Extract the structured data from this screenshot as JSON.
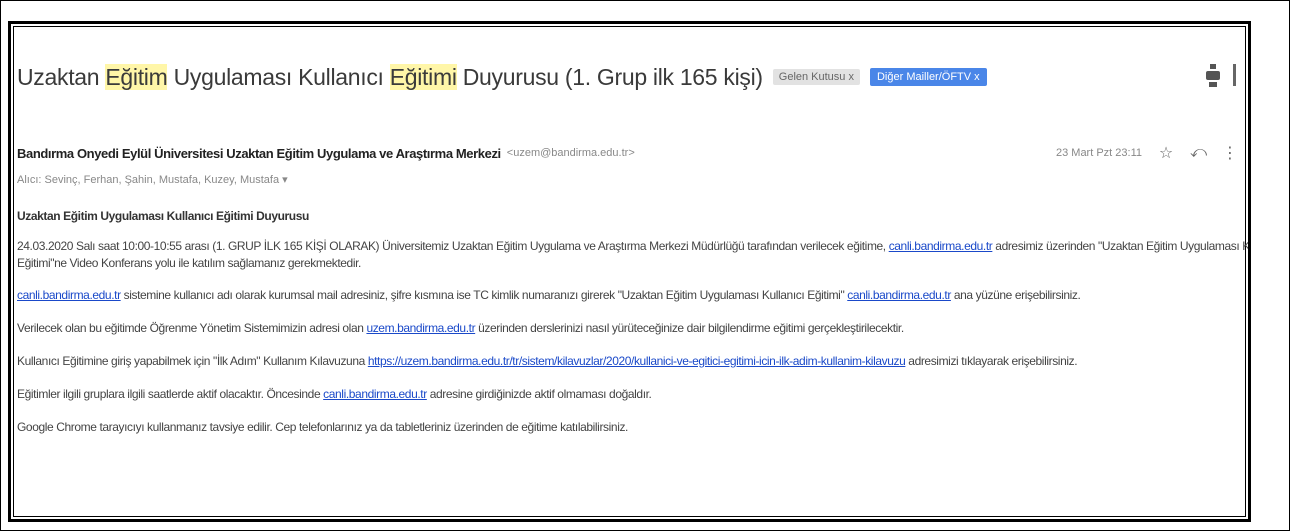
{
  "email": {
    "subject": {
      "p1": "Uzaktan ",
      "h1": "Eğitim",
      "p2": " Uygulaması Kullanıcı ",
      "h2": "Eğitimi",
      "p3": " Duyurusu (1. Grup ilk 165 kişi)"
    },
    "labels": {
      "inbox": "Gelen Kutusu x",
      "other": "Diğer Mailler/ÖFTV x"
    },
    "sender": {
      "name": "Bandırma Onyedi Eylül Üniversitesi Uzaktan Eğitim Uygulama ve Araştırma Merkezi",
      "email": "<uzem@bandirma.edu.tr>"
    },
    "date": "23 Mart Pzt 23:11",
    "recipients": "Alıcı: Sevinç, Ferhan, Şahin, Mustafa, Kuzey, Mustafa ▾",
    "body": {
      "heading": "Uzaktan Eğitim Uygulaması Kullanıcı Eğitimi Duyurusu",
      "p1a": "24.03.2020 Salı saat 10:00-10:55 arası (1. GRUP İLK 165 KİŞİ OLARAK) Üniversitemiz Uzaktan Eğitim Uygulama ve Araştırma Merkezi Müdürlüğü tarafından verilecek eğitime, ",
      "p1link": "canli.bandirma.edu.tr",
      "p1b": " adresimiz üzerinden \"Uzaktan Eğitim Uygulaması Kullanıcı",
      "p1c": "Eğitimi\"ne Video Konferans yolu ile katılım sağlamanız gerekmektedir.",
      "p2link": "canli.bandirma.edu.tr",
      "p2a": " sistemine kullanıcı adı olarak kurumsal mail adresiniz, şifre kısmına ise TC kimlik numaranızı girerek \"Uzaktan Eğitim Uygulaması Kullanıcı Eğitimi\" ",
      "p2link2": "canli.bandirma.edu.tr",
      "p2b": " ana yüzüne erişebilirsiniz.",
      "p3a": "Verilecek olan bu eğitimde Öğrenme Yönetim Sistemimizin adresi olan ",
      "p3link": "uzem.bandirma.edu.tr",
      "p3b": " üzerinden derslerinizi nasıl yürüteceğinize dair bilgilendirme eğitimi gerçekleştirilecektir.",
      "p4a": "Kullanıcı Eğitimine giriş yapabilmek için \"İlk Adım\" Kullanım Kılavuzuna ",
      "p4link": "https://uzem.bandirma.edu.tr/tr/sistem/kilavuzlar/2020/kullanici-ve-egitici-egitimi-icin-ilk-adim-kullanim-kilavuzu",
      "p4b": " adresimizi tıklayarak erişebilirsiniz.",
      "p5a": "Eğitimler ilgili gruplara ilgili saatlerde aktif olacaktır. Öncesinde ",
      "p5link": "canli.bandirma.edu.tr",
      "p5b": " adresine girdiğinizde aktif olmaması doğaldır.",
      "p6": "Google Chrome tarayıcıyı kullanmanız tavsiye edilir. Cep telefonlarınız ya da tabletleriniz üzerinden de eğitime katılabilirsiniz."
    }
  },
  "icons": {
    "print": "print-icon",
    "new_window": "new-window-icon",
    "star": "☆",
    "reply": "⤺",
    "more": "⋮"
  }
}
